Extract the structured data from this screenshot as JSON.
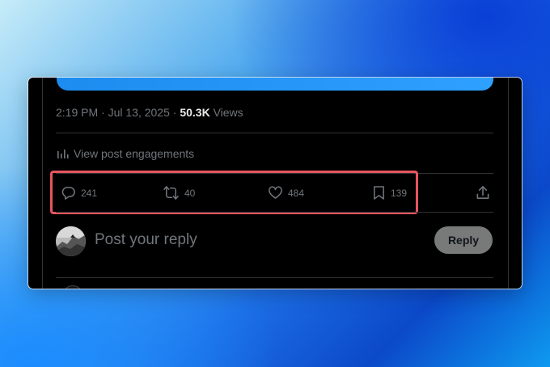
{
  "post": {
    "timestamp": "2:19 PM · Jul 13, 2025",
    "separator": " · ",
    "views_count": "50.3K",
    "views_label": " Views",
    "engagements_label": "View post engagements"
  },
  "actions": {
    "replies": "241",
    "reposts": "40",
    "likes": "484",
    "bookmarks": "139"
  },
  "reply": {
    "placeholder": "Post your reply",
    "button_label": "Reply"
  },
  "colors": {
    "highlight": "#e8555d",
    "muted_text": "#71767b",
    "divider": "#2f3336"
  }
}
